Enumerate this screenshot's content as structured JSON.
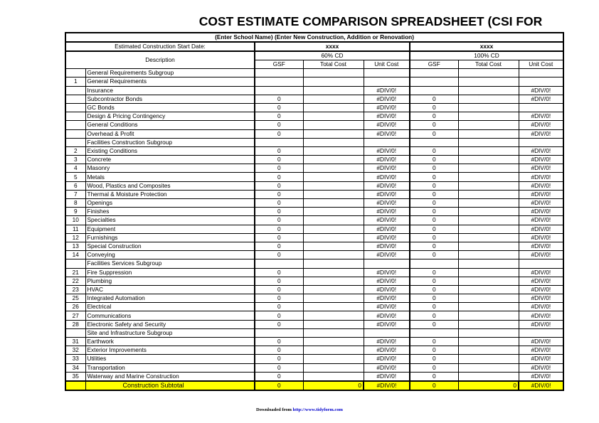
{
  "document": {
    "title": "COST ESTIMATE COMPARISON SPREADSHEET (CSI FOR",
    "subtitle": "(Enter School Name) (Enter New Construction, Addition or Renovation)"
  },
  "header": {
    "start_date_label": "Estimated Construction Start Date:",
    "start_date_value_1": "xxxx",
    "start_date_value_2": "xxxx",
    "description_label": "Description",
    "group_1": "60% CD",
    "group_2": "100% CD",
    "col_gsf": "GSF",
    "col_total_cost": "Total Cost",
    "col_unit_cost": "Unit Cost"
  },
  "colors": {
    "accent_blue": "#0000A0",
    "highlight_yellow": "#FFFF00",
    "link_blue": "#0000CC"
  },
  "rows": [
    {
      "type": "group",
      "label": "General Requirements Subgroup",
      "num": "",
      "c": [
        "",
        "",
        "",
        "",
        "",
        ""
      ]
    },
    {
      "type": "item",
      "num": "1",
      "label": "General Requirements",
      "c": [
        "",
        "",
        "",
        "",
        "",
        ""
      ]
    },
    {
      "type": "item",
      "num": "",
      "label": "Insurance",
      "c": [
        "",
        "",
        "#DIV/0!",
        "",
        "",
        "#DIV/0!"
      ]
    },
    {
      "type": "item",
      "num": "",
      "label": "Subcontractor Bonds",
      "c": [
        "0",
        "",
        "#DIV/0!",
        "0",
        "",
        "#DIV/0!"
      ]
    },
    {
      "type": "item",
      "num": "",
      "label": "GC Bonds",
      "c": [
        "0",
        "",
        "#DIV/0!",
        "0",
        "",
        ""
      ]
    },
    {
      "type": "item",
      "num": "",
      "label": "Design & Pricing Contingency",
      "c": [
        "0",
        "",
        "#DIV/0!",
        "0",
        "",
        "#DIV/0!"
      ]
    },
    {
      "type": "item",
      "num": "",
      "label": "General Conditions",
      "c": [
        "0",
        "",
        "#DIV/0!",
        "0",
        "",
        "#DIV/0!"
      ]
    },
    {
      "type": "item",
      "num": "",
      "label": "Overhead & Profit",
      "c": [
        "0",
        "",
        "#DIV/0!",
        "0",
        "",
        "#DIV/0!"
      ]
    },
    {
      "type": "group",
      "label": "Facilities Construction Subgroup",
      "num": "",
      "c": [
        "",
        "",
        "",
        "",
        "",
        ""
      ]
    },
    {
      "type": "item",
      "num": "2",
      "label": "Existing Conditions",
      "c": [
        "0",
        "",
        "#DIV/0!",
        "0",
        "",
        "#DIV/0!"
      ]
    },
    {
      "type": "item",
      "num": "3",
      "label": "Concrete",
      "c": [
        "0",
        "",
        "#DIV/0!",
        "0",
        "",
        "#DIV/0!"
      ]
    },
    {
      "type": "item",
      "num": "4",
      "label": "Masonry",
      "c": [
        "0",
        "",
        "#DIV/0!",
        "0",
        "",
        "#DIV/0!"
      ]
    },
    {
      "type": "item",
      "num": "5",
      "label": "Metals",
      "c": [
        "0",
        "",
        "#DIV/0!",
        "0",
        "",
        "#DIV/0!"
      ]
    },
    {
      "type": "item",
      "num": "6",
      "label": "Wood, Plastics and Composites",
      "c": [
        "0",
        "",
        "#DIV/0!",
        "0",
        "",
        "#DIV/0!"
      ]
    },
    {
      "type": "item",
      "num": "7",
      "label": "Thermal & Moisture Protection",
      "c": [
        "0",
        "",
        "#DIV/0!",
        "0",
        "",
        "#DIV/0!"
      ]
    },
    {
      "type": "item",
      "num": "8",
      "label": "Openings",
      "c": [
        "0",
        "",
        "#DIV/0!",
        "0",
        "",
        "#DIV/0!"
      ]
    },
    {
      "type": "item",
      "num": "9",
      "label": "Finishes",
      "c": [
        "0",
        "",
        "#DIV/0!",
        "0",
        "",
        "#DIV/0!"
      ]
    },
    {
      "type": "item",
      "num": "10",
      "label": "Specialties",
      "c": [
        "0",
        "",
        "#DIV/0!",
        "0",
        "",
        "#DIV/0!"
      ]
    },
    {
      "type": "item",
      "num": "11",
      "label": "Equipment",
      "c": [
        "0",
        "",
        "#DIV/0!",
        "0",
        "",
        "#DIV/0!"
      ]
    },
    {
      "type": "item",
      "num": "12",
      "label": "Furnishings",
      "c": [
        "0",
        "",
        "#DIV/0!",
        "0",
        "",
        "#DIV/0!"
      ]
    },
    {
      "type": "item",
      "num": "13",
      "label": "Special Construction",
      "c": [
        "0",
        "",
        "#DIV/0!",
        "0",
        "",
        "#DIV/0!"
      ]
    },
    {
      "type": "item",
      "num": "14",
      "label": "Conveying",
      "c": [
        "0",
        "",
        "#DIV/0!",
        "0",
        "",
        "#DIV/0!"
      ]
    },
    {
      "type": "group",
      "label": "Facilities Services Subgroup",
      "num": "",
      "c": [
        "",
        "",
        "",
        "",
        "",
        ""
      ]
    },
    {
      "type": "item",
      "num": "21",
      "label": "Fire Suppression",
      "c": [
        "0",
        "",
        "#DIV/0!",
        "0",
        "",
        "#DIV/0!"
      ]
    },
    {
      "type": "item",
      "num": "22",
      "label": "Plumbing",
      "c": [
        "0",
        "",
        "#DIV/0!",
        "0",
        "",
        "#DIV/0!"
      ]
    },
    {
      "type": "item",
      "num": "23",
      "label": "HVAC",
      "c": [
        "0",
        "",
        "#DIV/0!",
        "0",
        "",
        "#DIV/0!"
      ]
    },
    {
      "type": "item",
      "num": "25",
      "label": "Integrated Automation",
      "c": [
        "0",
        "",
        "#DIV/0!",
        "0",
        "",
        "#DIV/0!"
      ]
    },
    {
      "type": "item",
      "num": "26",
      "label": "Electrical",
      "c": [
        "0",
        "",
        "#DIV/0!",
        "0",
        "",
        "#DIV/0!"
      ]
    },
    {
      "type": "item",
      "num": "27",
      "label": "Communications",
      "c": [
        "0",
        "",
        "#DIV/0!",
        "0",
        "",
        "#DIV/0!"
      ]
    },
    {
      "type": "item",
      "num": "28",
      "label": "Electronic Safety and Security",
      "c": [
        "0",
        "",
        "#DIV/0!",
        "0",
        "",
        "#DIV/0!"
      ]
    },
    {
      "type": "group",
      "label": "Site and Infrastructure Subgroup",
      "num": "",
      "c": [
        "",
        "",
        "",
        "",
        "",
        ""
      ]
    },
    {
      "type": "item",
      "num": "31",
      "label": "Earthwork",
      "c": [
        "0",
        "",
        "#DIV/0!",
        "0",
        "",
        "#DIV/0!"
      ]
    },
    {
      "type": "item",
      "num": "32",
      "label": "Exterior Improvements",
      "c": [
        "0",
        "",
        "#DIV/0!",
        "0",
        "",
        "#DIV/0!"
      ]
    },
    {
      "type": "item",
      "num": "33",
      "label": "Utilities",
      "c": [
        "0",
        "",
        "#DIV/0!",
        "0",
        "",
        "#DIV/0!"
      ]
    },
    {
      "type": "item",
      "num": "34",
      "label": "Transportation",
      "c": [
        "0",
        "",
        "#DIV/0!",
        "0",
        "",
        "#DIV/0!"
      ]
    },
    {
      "type": "item",
      "num": "35",
      "label": "Waterway and Marine Construction",
      "c": [
        "0",
        "",
        "#DIV/0!",
        "0",
        "",
        "#DIV/0!"
      ]
    }
  ],
  "subtotal": {
    "label": "Construction Subtotal",
    "c": [
      "0",
      "0",
      "#DIV/0!",
      "0",
      "0",
      "#DIV/0!"
    ]
  },
  "footer": {
    "prefix": "Downloaded from ",
    "link": "http://www.tidyform.com"
  }
}
